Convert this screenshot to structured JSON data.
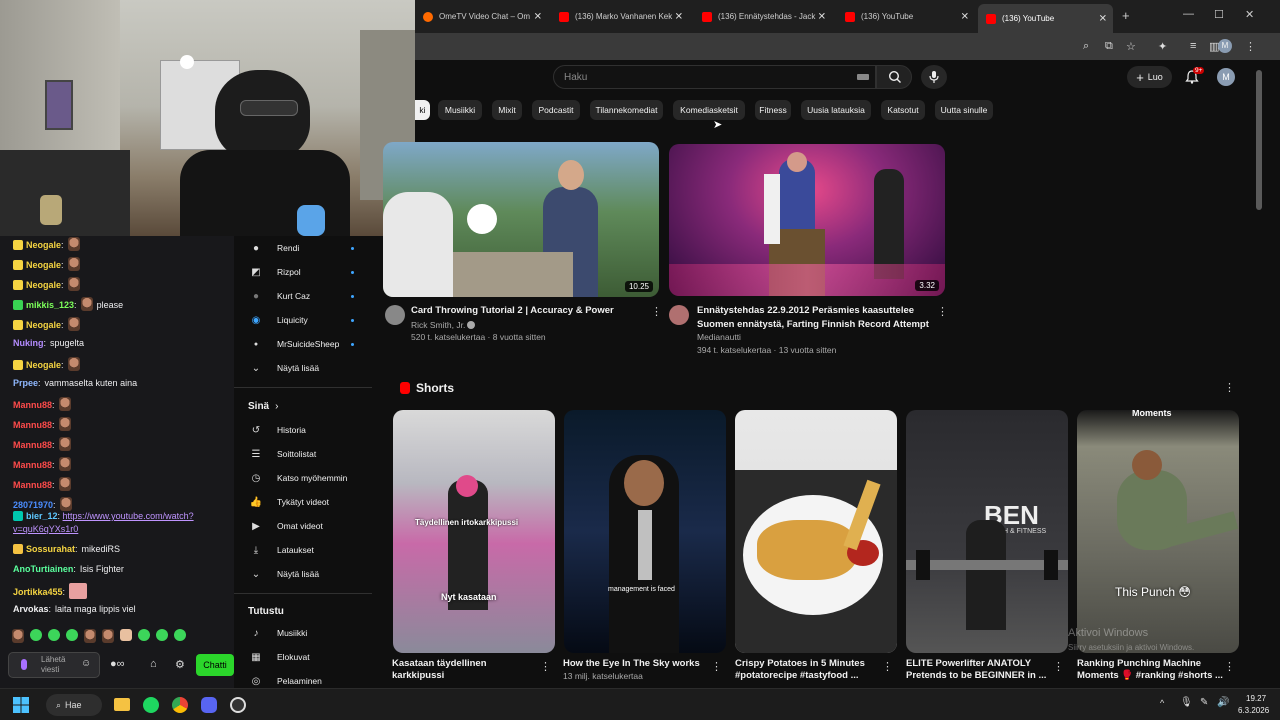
{
  "browser": {
    "tabs": [
      {
        "title": "OmeTV Video Chat – Om",
        "kind": "ome"
      },
      {
        "title": "(136) Marko Vanhanen Kek",
        "kind": "yt"
      },
      {
        "title": "(136) Ennätystehdas - Jack",
        "kind": "yt"
      },
      {
        "title": "(136) YouTube",
        "kind": "yt"
      },
      {
        "title": "(136) YouTube",
        "kind": "yt",
        "active": true
      }
    ],
    "new_tab_icon": "+",
    "profile_initial": "M"
  },
  "youtube": {
    "search_placeholder": "Haku",
    "create_label": "Luo",
    "notification_count": "9+",
    "avatar_initial": "M",
    "chips": [
      "Musiikki",
      "Mixit",
      "Podcastit",
      "Tilannekomediat",
      "Komediasketsit",
      "Fitness",
      "Uusia latauksia",
      "Katsotut",
      "Uutta sinulle"
    ],
    "chip_partial": "ki",
    "videos": [
      {
        "title": "Card Throwing Tutorial 2 | Accuracy & Power",
        "channel": "Rick Smith, Jr.",
        "stats": "520 t. katselukertaa · 8 vuotta sitten",
        "duration": "10.25"
      },
      {
        "title_line1": "Ennätystehdas 22.9.2012 Peräsmies kaasuttelee",
        "title_line2": "Suomen ennätystä, Farting Finnish Record Attempt",
        "channel": "Medianautti",
        "stats": "394 t. katselukertaa · 13 vuotta sitten",
        "duration": "3.32"
      }
    ],
    "shorts_heading": "Shorts",
    "shorts": [
      {
        "title_line1": "Kasataan täydellinen",
        "title_line2": "karkkipussi",
        "meta": "",
        "overlay_top": "Täydellinen irtokarkkipussi",
        "overlay_bottom": "Nyt kasataan"
      },
      {
        "title_line1": "How the Eye In The Sky works",
        "title_line2": "",
        "meta": "13 milj. katselukertaa",
        "overlay_top": "",
        "overlay_bottom": "management is faced"
      },
      {
        "title_line1": "Crispy Potatoes in 5 Minutes",
        "title_line2": "#potatorecipe #tastyfood ...",
        "meta": "",
        "overlay_top": "",
        "overlay_bottom": ""
      },
      {
        "title_line1": "ELITE Powerlifter ANATOLY",
        "title_line2": "Pretends to be BEGINNER in ...",
        "meta": "",
        "overlay_top": "BEN",
        "overlay_bottom": "EALTH & FITNESS"
      },
      {
        "title_line1": "Ranking Punching Machine",
        "title_line2": "Moments 🥊 #ranking #shorts ...",
        "meta": "",
        "overlay_top": "Moments",
        "overlay_bottom": "This Punch 😳"
      }
    ],
    "activate_windows_1": "Aktivoi Windows",
    "activate_windows_2": "Siirry asetuksiin ja aktivoi Windows."
  },
  "sidebar": {
    "subscriptions": [
      {
        "label": "Rendi",
        "icon": "avatar-rendi"
      },
      {
        "label": "Rizpol",
        "icon": "avatar-rizpol"
      },
      {
        "label": "Kurt Caz",
        "icon": "avatar-kurtcaz"
      },
      {
        "label": "Liquicity",
        "icon": "avatar-liquicity"
      },
      {
        "label": "MrSuicideSheep",
        "icon": "avatar-mrsuicidesheep"
      }
    ],
    "show_more_1": "Näytä lisää",
    "you_heading": "Sinä",
    "you_items": [
      {
        "label": "Historia",
        "icon": "history-icon"
      },
      {
        "label": "Soittolistat",
        "icon": "playlists-icon"
      },
      {
        "label": "Katso myöhemmin",
        "icon": "watch-later-icon"
      },
      {
        "label": "Tykätyt videot",
        "icon": "liked-icon"
      },
      {
        "label": "Omat videot",
        "icon": "your-videos-icon"
      },
      {
        "label": "Lataukset",
        "icon": "downloads-icon"
      }
    ],
    "show_more_2": "Näytä lisää",
    "explore_heading": "Tutustu",
    "explore_items": [
      {
        "label": "Musiikki",
        "icon": "music-icon"
      },
      {
        "label": "Elokuvat",
        "icon": "movies-icon"
      },
      {
        "label": "Pelaaminen",
        "icon": "gaming-icon"
      }
    ]
  },
  "chat": {
    "messages": [
      {
        "user": "Neogale",
        "text": "",
        "color": "#f5d442",
        "emote": true
      },
      {
        "user": "Neogale",
        "text": "",
        "color": "#f5d442",
        "emote": true
      },
      {
        "user": "Neogale",
        "text": "",
        "color": "#f5d442",
        "emote": true
      },
      {
        "user": "mikkis_123",
        "text": "please",
        "color": "#7cff5a",
        "emote": true
      },
      {
        "user": "Neogale",
        "text": "",
        "color": "#f5d442",
        "emote": true
      },
      {
        "user": "Nuking",
        "text": "spugelta",
        "color": "#b48cff",
        "emote": false
      },
      {
        "user": "Neogale",
        "text": "",
        "color": "#f5d442",
        "emote": true
      },
      {
        "user": "Prpee",
        "text": "vammaselta kuten aina",
        "color": "#8fb8ff",
        "emote": false
      },
      {
        "user": "Mannu88",
        "text": "",
        "color": "#ff4b4b",
        "emote": true
      },
      {
        "user": "Mannu88",
        "text": "",
        "color": "#ff4b4b",
        "emote": true
      },
      {
        "user": "Mannu88",
        "text": "",
        "color": "#ff4b4b",
        "emote": true
      },
      {
        "user": "Mannu88",
        "text": "",
        "color": "#ff4b4b",
        "emote": true
      },
      {
        "user": "Mannu88",
        "text": "",
        "color": "#ff4b4b",
        "emote": true
      },
      {
        "user": "28071970",
        "text": "",
        "color": "#4b8dff",
        "emote": true
      }
    ],
    "link_user": "bier_12",
    "link_text_1": "https://www.youtube.com/watch?",
    "link_text_2": "v=quK6qYXs1r0",
    "msg_after": [
      {
        "user": "Sossurahat",
        "text": "mikediRS",
        "color": "#f5d442"
      },
      {
        "user": "AnoTurtiainen",
        "text": "Isis Fighter",
        "color": "#5aff9d"
      },
      {
        "user": "Jortikka455",
        "text": "",
        "color": "#f5d442"
      },
      {
        "user": "Arvokas",
        "text": "laita maga lippis viel",
        "color": "#efeff1"
      }
    ],
    "input_placeholder": "Lähetä viesti",
    "chat_button": "Chatti"
  },
  "taskbar": {
    "search_label": "Hae",
    "time": "19.27",
    "date": "6.3.2026"
  }
}
